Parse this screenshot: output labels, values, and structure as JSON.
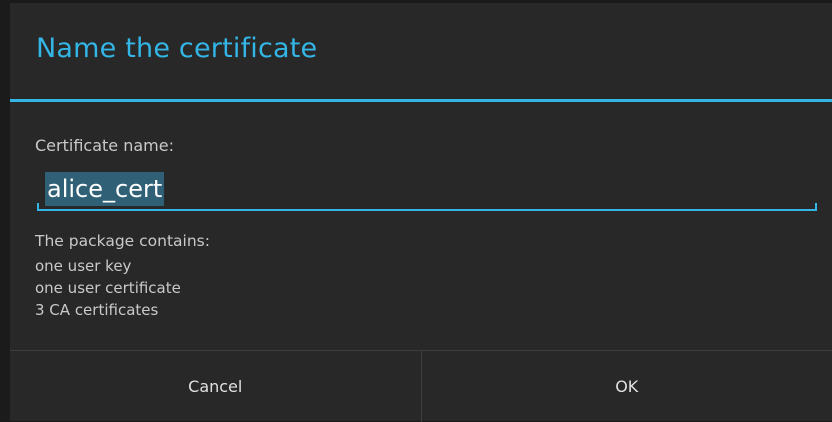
{
  "dialog": {
    "title": "Name the certificate",
    "field_label": "Certificate name:",
    "field_value": "alice_cert",
    "info_heading": "The package contains:",
    "info_items": [
      "one user key",
      "one user certificate",
      "3 CA certificates"
    ],
    "buttons": {
      "cancel": "Cancel",
      "ok": "OK"
    }
  },
  "colors": {
    "accent": "#33b5e5",
    "background": "#282828",
    "selection": "#2f6076"
  }
}
